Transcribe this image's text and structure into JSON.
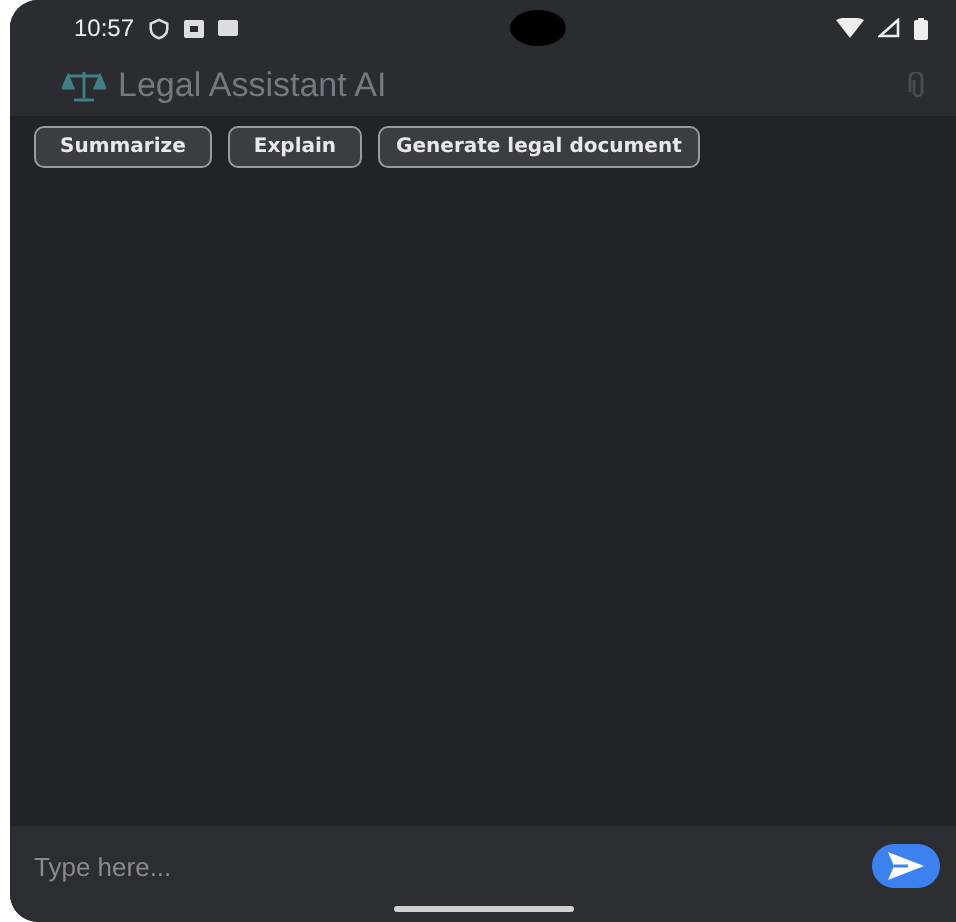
{
  "status_bar": {
    "time": "10:57"
  },
  "app_bar": {
    "title": "Legal Assistant AI"
  },
  "actions": [
    {
      "label": "Summarize"
    },
    {
      "label": "Explain"
    },
    {
      "label": "Generate legal document"
    }
  ],
  "composer": {
    "placeholder": "Type here..."
  }
}
